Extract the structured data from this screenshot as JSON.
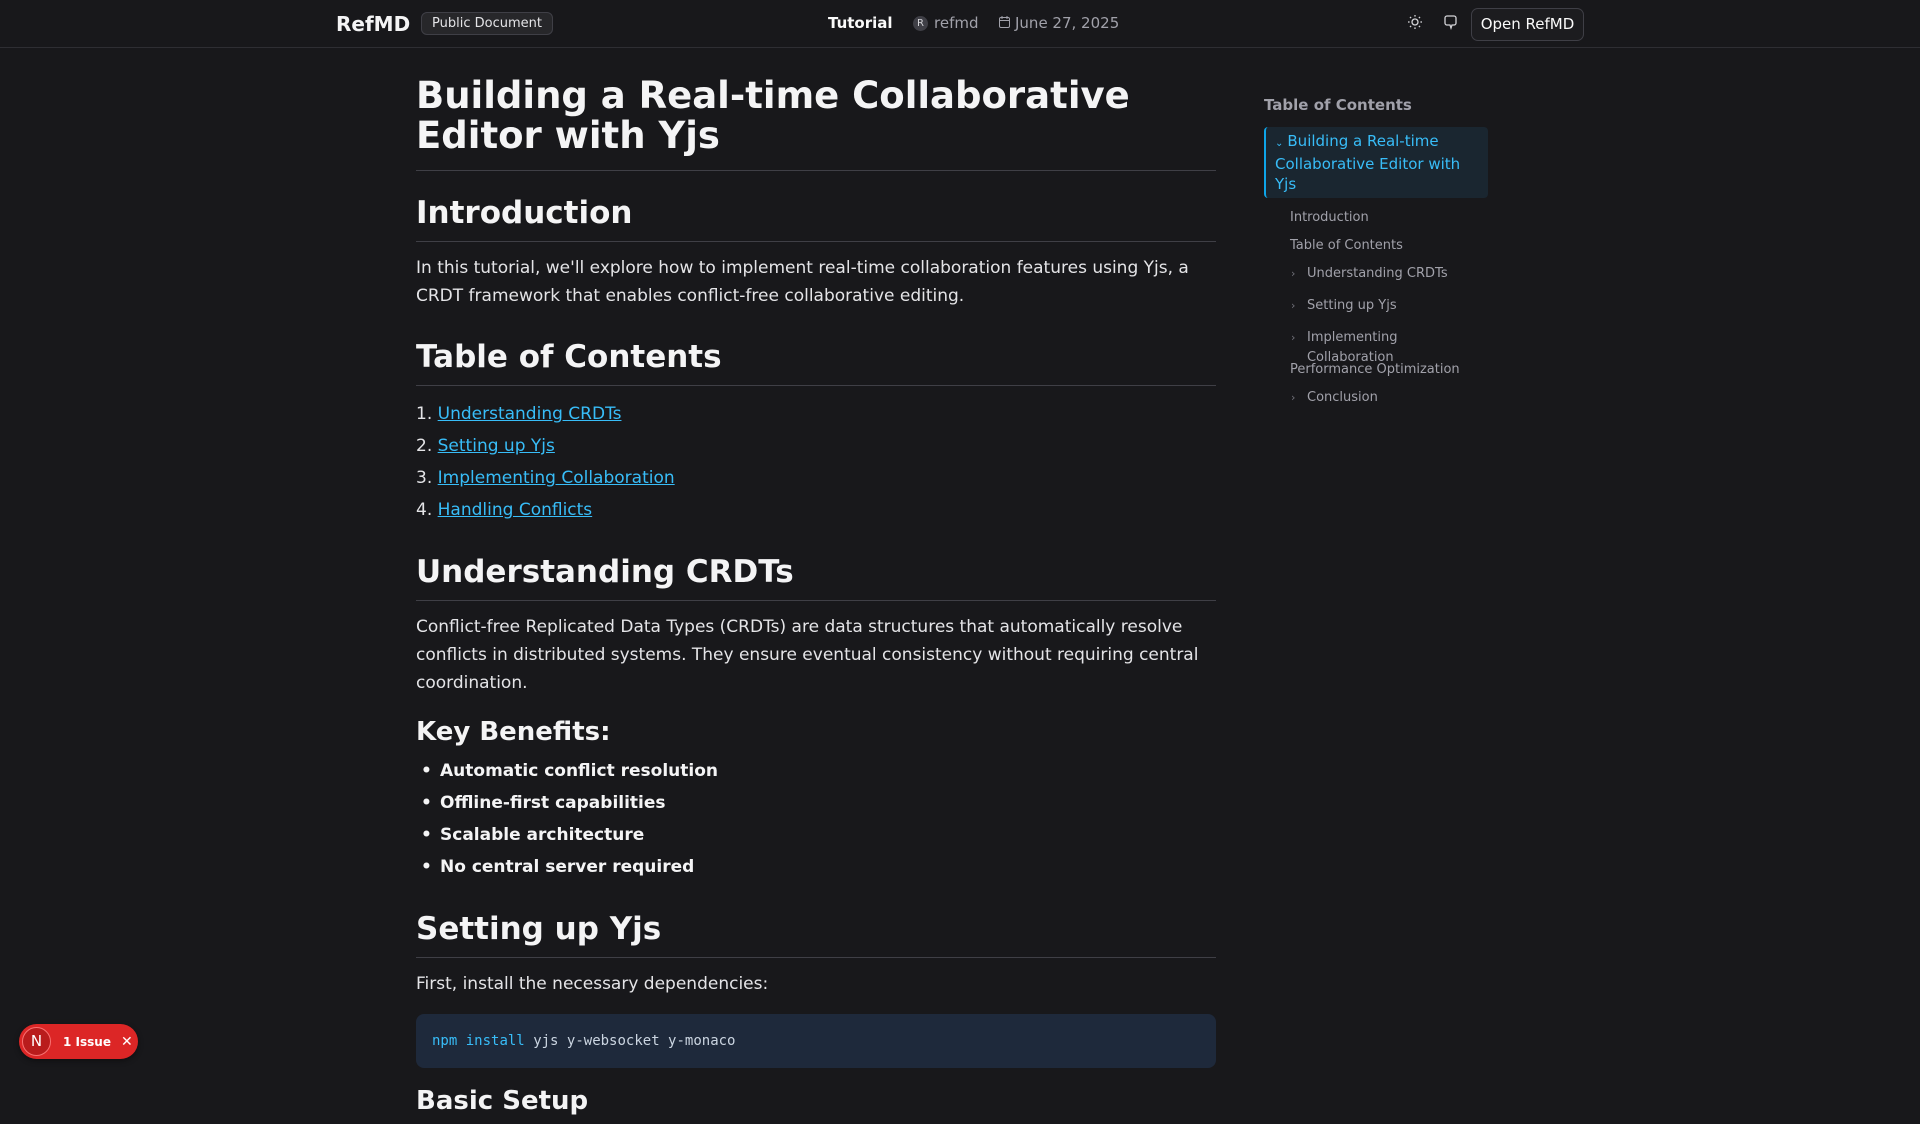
{
  "header": {
    "brand": "RefMD",
    "badge": "Public Document",
    "title": "Tutorial",
    "author_initial": "R",
    "author": "refmd",
    "date": "June 27, 2025",
    "open_button": "Open RefMD",
    "icons": [
      "sun-icon",
      "github-icon",
      "calendar-icon"
    ]
  },
  "article": {
    "title": "Building a Real-time Collaborative Editor with Yjs",
    "intro_heading": "Introduction",
    "intro_text": "In this tutorial, we'll explore how to implement real-time collaboration features using Yjs, a CRDT framework that enables conflict-free collaborative editing.",
    "toc_heading": "Table of Contents",
    "toc_items": [
      {
        "num": "1.",
        "label": "Understanding CRDTs"
      },
      {
        "num": "2.",
        "label": "Setting up Yjs"
      },
      {
        "num": "3.",
        "label": "Implementing Collaboration"
      },
      {
        "num": "4.",
        "label": "Handling Conflicts"
      }
    ],
    "crdt_heading": "Understanding CRDTs",
    "crdt_text": "Conflict-free Replicated Data Types (CRDTs) are data structures that automatically resolve conflicts in distributed systems. They ensure eventual consistency without requiring central coordination.",
    "benefits_heading": "Key Benefits:",
    "benefits": [
      "Automatic conflict resolution",
      "Offline-first capabilities",
      "Scalable architecture",
      "No central server required"
    ],
    "setup_heading": "Setting up Yjs",
    "setup_text": "First, install the necessary dependencies:",
    "code": {
      "cmd": "npm",
      "sub": "install",
      "args": "yjs y-websocket y-monaco"
    },
    "basic_heading": "Basic Setup"
  },
  "sidebar_toc": {
    "heading": "Table of Contents",
    "active": "Building a Real-time Collaborative Editor with Yjs",
    "items": [
      {
        "label": "Introduction"
      },
      {
        "label": "Table of Contents"
      },
      {
        "label": "Understanding CRDTs"
      },
      {
        "label": "Setting up Yjs"
      },
      {
        "label": "Implementing Collaboration"
      },
      {
        "label": "Performance Optimization"
      },
      {
        "label": "Conclusion"
      }
    ]
  },
  "issue_badge": {
    "initial": "N",
    "label": "1 Issue"
  },
  "colors": {
    "accent": "#38bdf8",
    "background": "#18181b",
    "issue": "#dc2626"
  }
}
